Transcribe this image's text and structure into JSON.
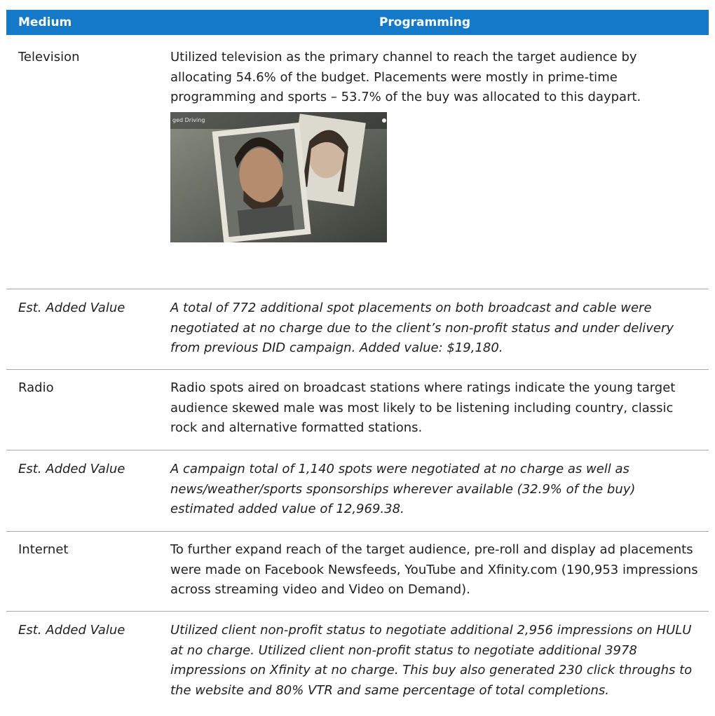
{
  "table": {
    "headers": {
      "medium": "Medium",
      "programming": "Programming"
    },
    "rows": [
      {
        "medium": "Television",
        "programming": "Utilized television as the primary channel to reach the target audience by allocating 54.6% of the budget.  Placements were mostly in prime-time programming and sports – 53.7% of the buy was allocated to this daypart.",
        "italic": false
      },
      {
        "medium": "Est. Added Value",
        "programming": "A total of 772 additional spot placements on both broadcast and cable were negotiated at no charge due to the client’s non-profit status and under delivery from previous DID campaign. Added value:  $19,180.",
        "italic": true
      },
      {
        "medium": "Radio",
        "programming": "Radio spots aired on broadcast stations where ratings indicate the young target audience skewed male was most likely to be listening including country, classic rock and alternative formatted stations.",
        "italic": false
      },
      {
        "medium": "Est. Added Value",
        "programming": "A campaign total of 1,140 spots were negotiated at no charge as well as news/weather/sports sponsorships wherever available (32.9% of the buy) estimated added value of 12,969.38.",
        "italic": true
      },
      {
        "medium": "Internet",
        "programming": "To further expand reach of the target audience, pre-roll and display ad placements were made on Facebook Newsfeeds, YouTube and Xfinity.com (190,953 impressions across streaming video and Video on Demand).",
        "italic": false
      },
      {
        "medium": "Est. Added Value",
        "programming": "Utilized client non-profit status to negotiate additional 2,956 impressions on HULU at no charge.  Utilized client non-profit status to negotiate additional 3978 impressions on Xfinity at no charge. This buy also generated 230 click throughs to the website and 80% VTR and same percentage of total completions.",
        "italic": true
      }
    ]
  },
  "video": {
    "caption": "ged Driving"
  }
}
